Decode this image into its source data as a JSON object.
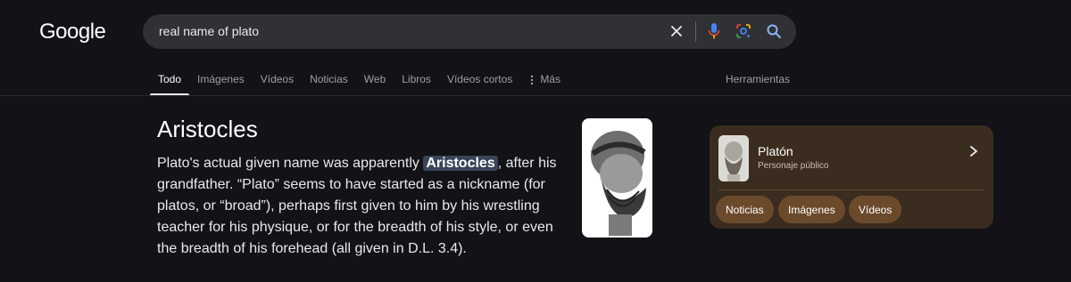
{
  "brand": {
    "logo_text": "Google"
  },
  "search": {
    "query": "real name of plato"
  },
  "icons": {
    "clear": "close-icon",
    "voice": "mic-icon",
    "lens": "google-lens-icon",
    "search": "search-icon",
    "more": "more-vertical-icon",
    "chevron": "chevron-right-icon"
  },
  "tabs": [
    {
      "label": "Todo",
      "active": true
    },
    {
      "label": "Imágenes",
      "active": false
    },
    {
      "label": "Vídeos",
      "active": false
    },
    {
      "label": "Noticias",
      "active": false
    },
    {
      "label": "Web",
      "active": false
    },
    {
      "label": "Libros",
      "active": false
    },
    {
      "label": "Vídeos cortos",
      "active": false
    },
    {
      "label": "Más",
      "active": false
    }
  ],
  "tools_label": "Herramientas",
  "featured": {
    "title": "Aristocles",
    "text_before": "Plato's actual given name was apparently ",
    "highlight": "Aristocles",
    "text_after": ", after his grandfather. “Plato” seems to have started as a nickname (for platos, or “broad”), perhaps first given to him by his wrestling teacher for his physique, or for the breadth of his style, or even the breadth of his forehead (all given in D.L. 3.4)."
  },
  "knowledge_panel": {
    "name": "Platón",
    "subtitle": "Personaje público",
    "chips": [
      "Noticias",
      "Imágenes",
      "Vídeos"
    ]
  },
  "colors": {
    "background": "#121217",
    "searchbar": "#303134",
    "panel": "#3a2c1f",
    "chip": "#6b4a2c",
    "highlight": "#394457"
  }
}
